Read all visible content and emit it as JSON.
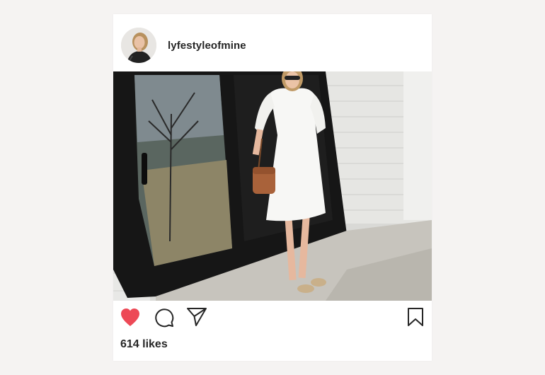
{
  "post": {
    "username": "lyfestyleofmine",
    "likes_text": "614 likes"
  },
  "icons": {
    "like": "heart-icon",
    "comment": "comment-icon",
    "share": "paper-plane-icon",
    "save": "bookmark-icon"
  },
  "colors": {
    "like_active": "#ed4956",
    "text_primary": "#262626",
    "page_background": "#f5f3f2",
    "card_background": "#ffffff"
  }
}
